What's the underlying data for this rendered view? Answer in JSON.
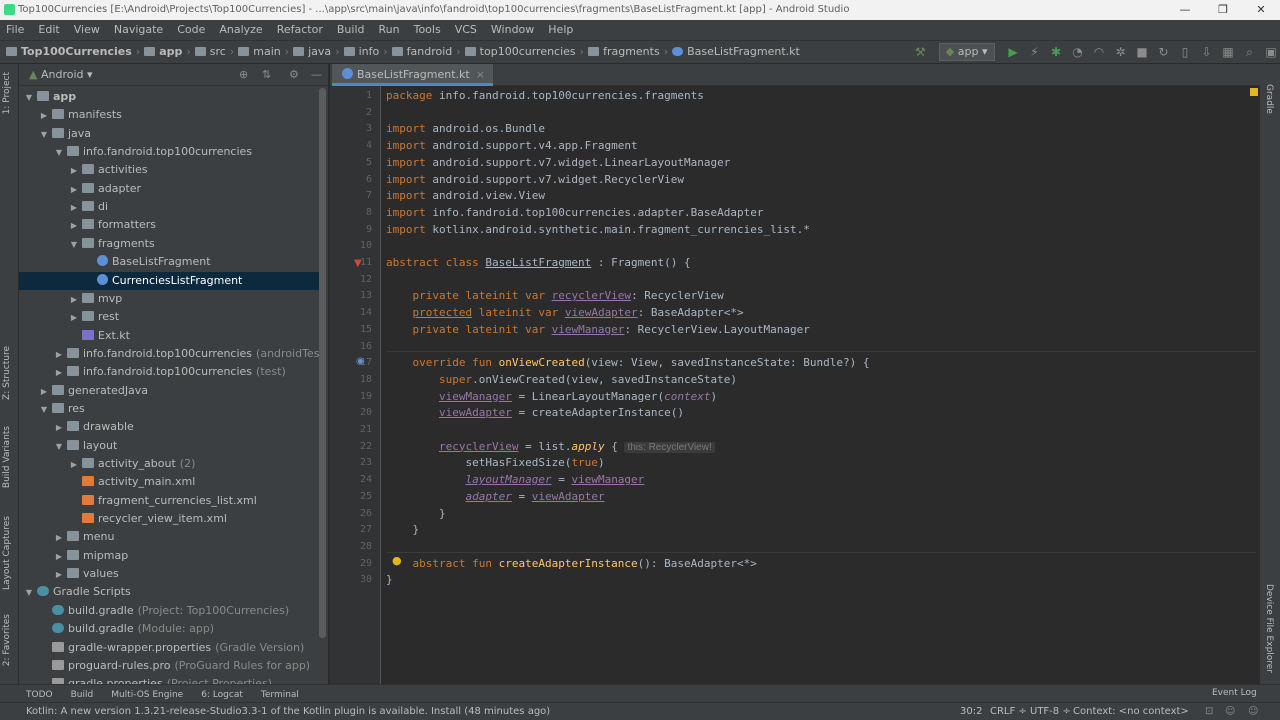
{
  "window": {
    "title": "Top100Currencies [E:\\Android\\Projects\\Top100Currencies] - ...\\app\\src\\main\\java\\info\\fandroid\\top100currencies\\fragments\\BaseListFragment.kt [app] - Android Studio",
    "minimize": "—",
    "maximize": "❐",
    "close": "✕"
  },
  "menu": [
    "File",
    "Edit",
    "View",
    "Navigate",
    "Code",
    "Analyze",
    "Refactor",
    "Build",
    "Run",
    "Tools",
    "VCS",
    "Window",
    "Help"
  ],
  "breadcrumbs": [
    "Top100Currencies",
    "app",
    "src",
    "main",
    "java",
    "info",
    "fandroid",
    "top100currencies",
    "fragments",
    "BaseListFragment.kt"
  ],
  "run_config": "app",
  "left_tabs": [
    "1: Project",
    "Z: Structure",
    "Build Variants",
    "Layout Captures",
    "2: Favorites"
  ],
  "right_tabs": [
    "Gradle",
    "Device File Explorer"
  ],
  "project": {
    "view": "Android"
  },
  "tree": [
    {
      "label": "app",
      "level": 0,
      "arrow": "▼",
      "icon": "folder",
      "bold": true
    },
    {
      "label": "manifests",
      "level": 1,
      "arrow": "▶",
      "icon": "folder"
    },
    {
      "label": "java",
      "level": 1,
      "arrow": "▼",
      "icon": "folder"
    },
    {
      "label": "info.fandroid.top100currencies",
      "level": 2,
      "arrow": "▼",
      "icon": "pkg"
    },
    {
      "label": "activities",
      "level": 3,
      "arrow": "▶",
      "icon": "pkg"
    },
    {
      "label": "adapter",
      "level": 3,
      "arrow": "▶",
      "icon": "pkg"
    },
    {
      "label": "di",
      "level": 3,
      "arrow": "▶",
      "icon": "pkg"
    },
    {
      "label": "formatters",
      "level": 3,
      "arrow": "▶",
      "icon": "pkg"
    },
    {
      "label": "fragments",
      "level": 3,
      "arrow": "▼",
      "icon": "pkg"
    },
    {
      "label": "BaseListFragment",
      "level": 4,
      "arrow": "",
      "icon": "kt"
    },
    {
      "label": "CurrenciesListFragment",
      "level": 4,
      "arrow": "",
      "icon": "kt",
      "selected": true
    },
    {
      "label": "mvp",
      "level": 3,
      "arrow": "▶",
      "icon": "pkg"
    },
    {
      "label": "rest",
      "level": 3,
      "arrow": "▶",
      "icon": "pkg"
    },
    {
      "label": "Ext.kt",
      "level": 3,
      "arrow": "",
      "icon": "kfile"
    },
    {
      "label": "info.fandroid.top100currencies",
      "suffix": "(androidTest)",
      "level": 2,
      "arrow": "▶",
      "icon": "pkg"
    },
    {
      "label": "info.fandroid.top100currencies",
      "suffix": "(test)",
      "level": 2,
      "arrow": "▶",
      "icon": "pkg"
    },
    {
      "label": "generatedJava",
      "level": 1,
      "arrow": "▶",
      "icon": "folder"
    },
    {
      "label": "res",
      "level": 1,
      "arrow": "▼",
      "icon": "folder"
    },
    {
      "label": "drawable",
      "level": 2,
      "arrow": "▶",
      "icon": "folder"
    },
    {
      "label": "layout",
      "level": 2,
      "arrow": "▼",
      "icon": "folder"
    },
    {
      "label": "activity_about",
      "suffix": "(2)",
      "level": 3,
      "arrow": "▶",
      "icon": "folder"
    },
    {
      "label": "activity_main.xml",
      "level": 3,
      "arrow": "",
      "icon": "xml"
    },
    {
      "label": "fragment_currencies_list.xml",
      "level": 3,
      "arrow": "",
      "icon": "xml"
    },
    {
      "label": "recycler_view_item.xml",
      "level": 3,
      "arrow": "",
      "icon": "xml"
    },
    {
      "label": "menu",
      "level": 2,
      "arrow": "▶",
      "icon": "folder"
    },
    {
      "label": "mipmap",
      "level": 2,
      "arrow": "▶",
      "icon": "folder"
    },
    {
      "label": "values",
      "level": 2,
      "arrow": "▶",
      "icon": "folder"
    },
    {
      "label": "Gradle Scripts",
      "level": 0,
      "arrow": "▼",
      "icon": "gradle"
    },
    {
      "label": "build.gradle",
      "suffix": "(Project: Top100Currencies)",
      "level": 1,
      "arrow": "",
      "icon": "gradle"
    },
    {
      "label": "build.gradle",
      "suffix": "(Module: app)",
      "level": 1,
      "arrow": "",
      "icon": "gradle"
    },
    {
      "label": "gradle-wrapper.properties",
      "suffix": "(Gradle Version)",
      "level": 1,
      "arrow": "",
      "icon": "prop"
    },
    {
      "label": "proguard-rules.pro",
      "suffix": "(ProGuard Rules for app)",
      "level": 1,
      "arrow": "",
      "icon": "prop"
    },
    {
      "label": "gradle.properties",
      "suffix": "(Project Properties)",
      "level": 1,
      "arrow": "",
      "icon": "prop"
    }
  ],
  "editor": {
    "tab": "BaseListFragment.kt",
    "tab_close": "×"
  },
  "code": [
    [
      [
        "kw",
        "package "
      ],
      [
        "",
        "info.fandroid.top100currencies.fragments"
      ]
    ],
    [],
    [
      [
        "kw",
        "import "
      ],
      [
        "",
        "android.os.Bundle"
      ]
    ],
    [
      [
        "kw",
        "import "
      ],
      [
        "",
        "android.support.v4.app.Fragment"
      ]
    ],
    [
      [
        "kw",
        "import "
      ],
      [
        "",
        "android.support.v7.widget.LinearLayoutManager"
      ]
    ],
    [
      [
        "kw",
        "import "
      ],
      [
        "",
        "android.support.v7.widget.RecyclerView"
      ]
    ],
    [
      [
        "kw",
        "import "
      ],
      [
        "",
        "android.view.View"
      ]
    ],
    [
      [
        "kw",
        "import "
      ],
      [
        "",
        "info.fandroid.top100currencies.adapter.BaseAdapter"
      ]
    ],
    [
      [
        "kw",
        "import "
      ],
      [
        "",
        "kotlinx.android.synthetic.main.fragment_currencies_list.*"
      ]
    ],
    [],
    [
      [
        "kw",
        "abstract class "
      ],
      [
        "ul",
        "BaseListFragment"
      ],
      [
        "",
        " : Fragment() {"
      ]
    ],
    [],
    [
      [
        "",
        "    "
      ],
      [
        "kw",
        "private lateinit var "
      ],
      [
        "pr ul",
        "recyclerView"
      ],
      [
        "",
        ": RecyclerView"
      ]
    ],
    [
      [
        "",
        "    "
      ],
      [
        "kw ul",
        "protected"
      ],
      [
        "kw",
        " lateinit var "
      ],
      [
        "pr ul",
        "viewAdapter"
      ],
      [
        "",
        ": BaseAdapter<*>"
      ]
    ],
    [
      [
        "",
        "    "
      ],
      [
        "kw",
        "private lateinit var "
      ],
      [
        "pr ul",
        "viewManager"
      ],
      [
        "",
        ": RecyclerView.LayoutManager"
      ]
    ],
    [],
    [
      [
        "",
        "    "
      ],
      [
        "kw",
        "override fun "
      ],
      [
        "fn",
        "onViewCreated"
      ],
      [
        "",
        "(view: View, savedInstanceState: Bundle?) {"
      ]
    ],
    [
      [
        "",
        "        "
      ],
      [
        "kw",
        "super"
      ],
      [
        "",
        ".onViewCreated(view, savedInstanceState)"
      ]
    ],
    [
      [
        "",
        "        "
      ],
      [
        "pr ul",
        "viewManager"
      ],
      [
        "",
        " = LinearLayoutManager("
      ],
      [
        "pr it",
        "context"
      ],
      [
        "",
        ")"
      ]
    ],
    [
      [
        "",
        "        "
      ],
      [
        "pr ul",
        "viewAdapter"
      ],
      [
        "",
        " = createAdapterInstance()"
      ]
    ],
    [],
    [
      [
        "",
        "        "
      ],
      [
        "pr ul",
        "recyclerView"
      ],
      [
        "",
        " = list."
      ],
      [
        "fn it",
        "apply"
      ],
      [
        "",
        " { "
      ],
      [
        "hint",
        "this: RecyclerView!"
      ]
    ],
    [
      [
        "",
        "            setHasFixedSize("
      ],
      [
        "kw",
        "true"
      ],
      [
        "",
        ")"
      ]
    ],
    [
      [
        "",
        "            "
      ],
      [
        "pr it ul",
        "layoutManager"
      ],
      [
        "",
        " = "
      ],
      [
        "pr ul",
        "viewManager"
      ]
    ],
    [
      [
        "",
        "            "
      ],
      [
        "pr it ul",
        "adapter"
      ],
      [
        "",
        " = "
      ],
      [
        "pr ul",
        "viewAdapter"
      ]
    ],
    [
      [
        "",
        "        }"
      ]
    ],
    [
      [
        "",
        "    }"
      ]
    ],
    [],
    [
      [
        "",
        "    "
      ],
      [
        "kw",
        "abstract fun "
      ],
      [
        "fn",
        "createAdapterInstance"
      ],
      [
        "",
        "(): BaseAdapter<*>"
      ]
    ],
    [
      [
        "",
        "}"
      ]
    ]
  ],
  "bottom_tools": [
    "TODO",
    "Build",
    "Multi-OS Engine",
    "6: Logcat",
    "Terminal"
  ],
  "event_log": "Event Log",
  "status": {
    "message": "Kotlin: A new version 1.3.21-release-Studio3.3-1 of the Kotlin plugin is available. Install (48 minutes ago)",
    "position": "30:2",
    "line_sep": "CRLF ÷",
    "encoding": "UTF-8 ÷",
    "context": "Context: <no context>"
  }
}
